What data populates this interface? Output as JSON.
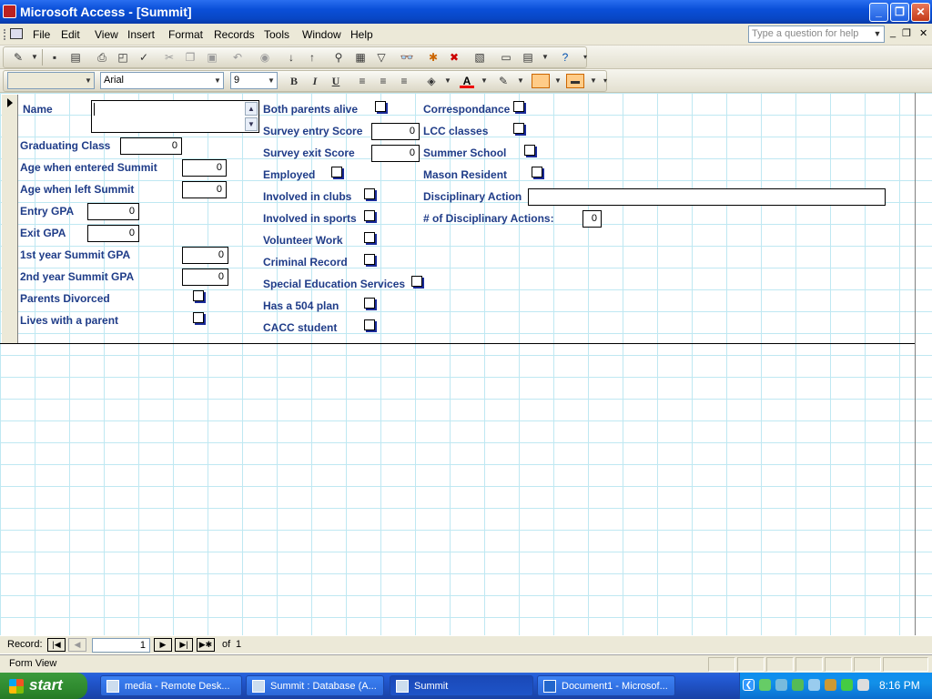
{
  "window": {
    "title": "Microsoft Access - [Summit]"
  },
  "menus": [
    "File",
    "Edit",
    "View",
    "Insert",
    "Format",
    "Records",
    "Tools",
    "Window",
    "Help"
  ],
  "help_box": {
    "placeholder": "Type a question for help"
  },
  "format_toolbar": {
    "font": "Arial",
    "size": "9",
    "bold": "B",
    "italic": "I",
    "underline": "U",
    "font_color_letter": "A"
  },
  "form": {
    "name_label": "Name",
    "name_value": "",
    "fields_left": [
      {
        "label": "Graduating Class",
        "value": "0"
      },
      {
        "label": "Age when entered Summit",
        "value": "0"
      },
      {
        "label": "Age when left Summit",
        "value": "0"
      },
      {
        "label": "Entry GPA",
        "value": "0"
      },
      {
        "label": "Exit GPA",
        "value": "0"
      },
      {
        "label": "1st year Summit GPA",
        "value": "0"
      },
      {
        "label": "2nd year Summit GPA",
        "value": "0"
      }
    ],
    "checks_left": [
      "Parents Divorced",
      "Lives with a parent"
    ],
    "middle": [
      {
        "label": "Both parents alive"
      },
      {
        "label": "Survey entry Score",
        "value": "0"
      },
      {
        "label": "Survey exit Score",
        "value": "0"
      },
      {
        "label": "Employed"
      },
      {
        "label": "Involved in clubs"
      },
      {
        "label": "Involved in sports"
      },
      {
        "label": "Volunteer Work"
      },
      {
        "label": "Criminal Record"
      },
      {
        "label": "Special Education Services"
      },
      {
        "label": "Has a 504 plan"
      },
      {
        "label": "CACC student"
      }
    ],
    "right": [
      {
        "label": "Correspondance"
      },
      {
        "label": "LCC classes"
      },
      {
        "label": "Summer School"
      },
      {
        "label": "Mason Resident"
      },
      {
        "label": "Disciplinary Action",
        "value": ""
      },
      {
        "label": "# of Disciplinary Actions:",
        "value": "0"
      }
    ]
  },
  "record_nav": {
    "label": "Record:",
    "current": "1",
    "of_label": "of",
    "total": "1"
  },
  "status_bar": {
    "text": "Form View"
  },
  "taskbar": {
    "start": "start",
    "tasks": [
      "media - Remote Desk...",
      "Summit : Database (A...",
      "Summit",
      "Document1 - Microsof..."
    ],
    "clock": "8:16 PM"
  }
}
